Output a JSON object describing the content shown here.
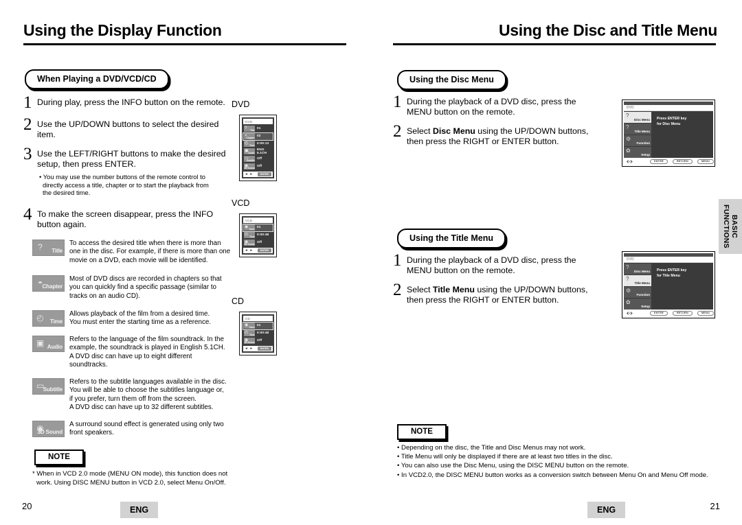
{
  "left_page": {
    "title": "Using the Display Function",
    "section_pill": "When Playing a DVD/VCD/CD",
    "steps": [
      {
        "num": "1",
        "text": "During play, press the INFO button on the remote."
      },
      {
        "num": "2",
        "text": "Use the UP/DOWN buttons to select the desired item."
      },
      {
        "num": "3",
        "text": "Use the LEFT/RIGHT buttons to make the desired setup, then press ENTER."
      },
      {
        "num": "4",
        "text": "To make the screen disappear, press the INFO button again."
      }
    ],
    "step3_bullets": [
      "• You may use the number buttons of the remote control to",
      "directly access a title, chapter or to start the playback from",
      "the desired time."
    ],
    "glossary": [
      {
        "icon": "title-icon",
        "icon_label": "Title",
        "glyph": "?",
        "lines": [
          "To access the desired title when there is more than",
          "one in the disc. For example, if there is more than one",
          "movie on a DVD, each movie will be identified."
        ]
      },
      {
        "icon": "chapter-icon",
        "icon_label": "Chapter",
        "glyph": "◓",
        "lines": [
          "Most of DVD discs are recorded in chapters so that",
          "you can quickly find a specific passage (similar to",
          "tracks on an audio CD)."
        ]
      },
      {
        "icon": "time-icon",
        "icon_label": "Time",
        "glyph": "◴",
        "lines": [
          "Allows playback of the film from a desired time.",
          "You must enter the starting time as a reference."
        ]
      },
      {
        "icon": "audio-icon",
        "icon_label": "Audio",
        "glyph": "▣",
        "lines": [
          "Refers to the language of the film soundtrack. In the",
          "example, the soundtrack is played in English 5.1CH.",
          "A DVD disc can have up to eight different",
          "soundtracks."
        ]
      },
      {
        "icon": "subtitle-icon",
        "icon_label": "Subtitle",
        "glyph": "▭",
        "lines": [
          "Refers to the subtitle languages available in the disc.",
          "You will be able to choose the subtitles language or,",
          "if you prefer, turn them off from the screen.",
          "A DVD disc can have up to 32 different subtitles."
        ]
      },
      {
        "icon": "3d-sound-icon",
        "icon_label": "3D Sound",
        "glyph": "◉",
        "lines": [
          "A surround sound effect is generated using only two",
          "front speakers."
        ]
      }
    ],
    "note": {
      "label": "NOTE",
      "lines": [
        "* When in VCD 2.0 mode (MENU ON mode), this function does not",
        "work. Using DISC MENU button in VCD 2.0, select Menu On/Off."
      ]
    },
    "osd_panels": [
      {
        "label": "DVD",
        "head": "DVD",
        "rows": [
          {
            "icon_label": "Title",
            "glyph": "?",
            "value": "01",
            "selected": false
          },
          {
            "icon_label": "Chapter",
            "glyph": "◓",
            "value": "02",
            "selected": true
          },
          {
            "icon_label": "Time",
            "glyph": "◴",
            "value": "0:00:13",
            "selected": false
          },
          {
            "icon_label": "Audio",
            "glyph": "▣",
            "value": "ENG 5.1CH",
            "selected": false
          },
          {
            "icon_label": "Subtitle",
            "glyph": "▭",
            "value": "Off",
            "selected": false
          },
          {
            "icon_label": "3D Sound",
            "glyph": "◉",
            "value": "Off",
            "selected": false
          }
        ],
        "foot_nav": "◄ ►",
        "foot_btn": "ENTER"
      },
      {
        "label": "VCD",
        "head": "VCD",
        "rows": [
          {
            "icon_label": "Track",
            "glyph": "◉",
            "value": "01",
            "selected": true
          },
          {
            "icon_label": "Time",
            "glyph": "◴",
            "value": "0:00:48",
            "selected": false
          },
          {
            "icon_label": "3D Sound",
            "glyph": "◉",
            "value": "Off",
            "selected": false
          }
        ],
        "foot_nav": "◄ ►",
        "foot_btn": "ENTER"
      },
      {
        "label": "CD",
        "head": "CD",
        "rows": [
          {
            "icon_label": "Track",
            "glyph": "◉",
            "value": "01",
            "selected": true
          },
          {
            "icon_label": "Time",
            "glyph": "◴",
            "value": "0:00:48",
            "selected": false
          },
          {
            "icon_label": "3D Sound",
            "glyph": "◉",
            "value": "Off",
            "selected": false
          }
        ],
        "foot_nav": "◄ ►",
        "foot_btn": "ENTER"
      }
    ],
    "page_number": "20",
    "language": "ENG"
  },
  "right_page": {
    "title": "Using the Disc and Title Menu",
    "disc_section": {
      "pill": "Using the Disc Menu",
      "steps": [
        {
          "num": "1",
          "before": "During the playback of a DVD disc, press the MENU button on the remote.",
          "bold": "",
          "after": ""
        },
        {
          "num": "2",
          "before": "Select ",
          "bold": "Disc Menu",
          "after": " using the UP/DOWN buttons, then press the RIGHT or ENTER button."
        }
      ]
    },
    "title_section": {
      "pill": "Using the Title Menu",
      "steps": [
        {
          "num": "1",
          "before": "During the playback of a DVD disc, press the MENU button on the remote.",
          "bold": "",
          "after": ""
        },
        {
          "num": "2",
          "before": "Select ",
          "bold": "Title Menu",
          "after": " using the UP/DOWN buttons, then press the RIGHT or ENTER button."
        }
      ]
    },
    "tv_screens": [
      {
        "head": "DVD",
        "message_lines": [
          "Press ENTER key",
          "for Disc Menu"
        ],
        "items": [
          {
            "label": "Disc Menu",
            "glyph": "?",
            "active": true
          },
          {
            "label": "Title Menu",
            "glyph": "?",
            "active": false
          },
          {
            "label": "Function",
            "glyph": "⚙",
            "active": false
          },
          {
            "label": "Setup",
            "glyph": "✿",
            "active": false
          }
        ],
        "nav": "⬖⬗",
        "buttons": [
          "ENTER",
          "RETURN",
          "MENU"
        ]
      },
      {
        "head": "DVD",
        "message_lines": [
          "Press ENTER key",
          "for Title Menu"
        ],
        "items": [
          {
            "label": "Disc Menu",
            "glyph": "?",
            "active": false
          },
          {
            "label": "Title Menu",
            "glyph": "?",
            "active": true
          },
          {
            "label": "Function",
            "glyph": "⚙",
            "active": false
          },
          {
            "label": "Setup",
            "glyph": "✿",
            "active": false
          }
        ],
        "nav": "⬖⬗",
        "buttons": [
          "ENTER",
          "RETURN",
          "MENU"
        ]
      }
    ],
    "note": {
      "label": "NOTE",
      "lines": [
        "• Depending on the disc, the Title and Disc Menus may not work.",
        "• Title Menu will only be displayed if there are at least two titles in the disc.",
        "• You can also use the Disc Menu, using the DISC MENU button on the remote.",
        "• In VCD2.0, the DISC MENU button works as a conversion switch between Menu On and Menu Off mode."
      ]
    },
    "page_number": "21",
    "language": "ENG"
  },
  "side_tab": {
    "line1": "BASIC",
    "line2": "FUNCTIONS"
  }
}
